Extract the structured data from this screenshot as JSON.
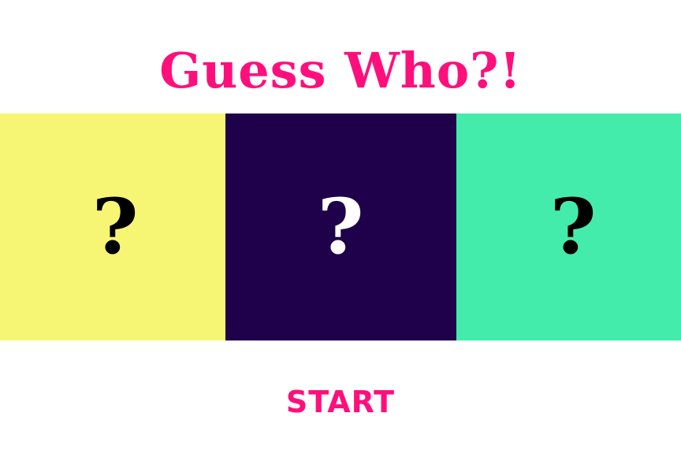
{
  "title": "Guess Who?!",
  "cards": [
    {
      "symbol": "?",
      "background": "#f7f674",
      "symbol_color": "#000000"
    },
    {
      "symbol": "?",
      "background": "#1f004a",
      "symbol_color": "#ffffff"
    },
    {
      "symbol": "?",
      "background": "#44ecab",
      "symbol_color": "#000000"
    }
  ],
  "start_label": "START",
  "colors": {
    "accent": "#ff0f7b",
    "background": "#ffffff"
  }
}
